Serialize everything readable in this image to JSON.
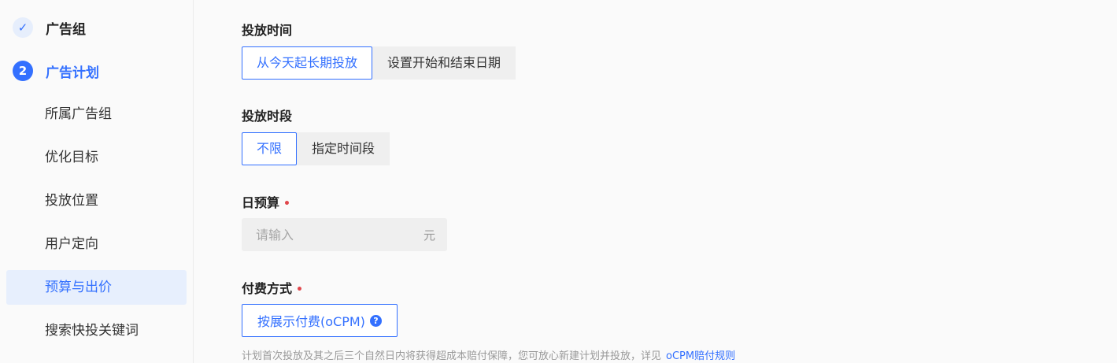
{
  "sidebar": {
    "steps": [
      {
        "label": "广告组",
        "icon": "check-icon",
        "icon_glyph": "✓"
      },
      {
        "label": "广告计划",
        "number": "2"
      }
    ],
    "sub_items": [
      "所属广告组",
      "优化目标",
      "投放位置",
      "用户定向",
      "预算与出价",
      "搜索快投关键词"
    ],
    "active_sub_item": "预算与出价"
  },
  "form": {
    "schedule": {
      "label": "投放时间",
      "options": [
        "从今天起长期投放",
        "设置开始和结束日期"
      ],
      "selected": "从今天起长期投放"
    },
    "time_slot": {
      "label": "投放时段",
      "options": [
        "不限",
        "指定时间段"
      ],
      "selected": "不限"
    },
    "daily_budget": {
      "label": "日预算",
      "required_mark": "•",
      "placeholder": "请输入",
      "unit": "元",
      "value": ""
    },
    "payment": {
      "label": "付费方式",
      "required_mark": "•",
      "button_label": "按展示付费(oCPM)",
      "help_icon": "question-icon",
      "help_glyph": "?"
    },
    "note": {
      "text": "计划首次投放及其之后三个自然日内将获得超成本赔付保障，您可放心新建计划并投放，详见",
      "link": "oCPM赔付规则"
    }
  },
  "colors": {
    "accent": "#3370ff",
    "required": "#e0464b",
    "active_bg": "#e7effd"
  }
}
